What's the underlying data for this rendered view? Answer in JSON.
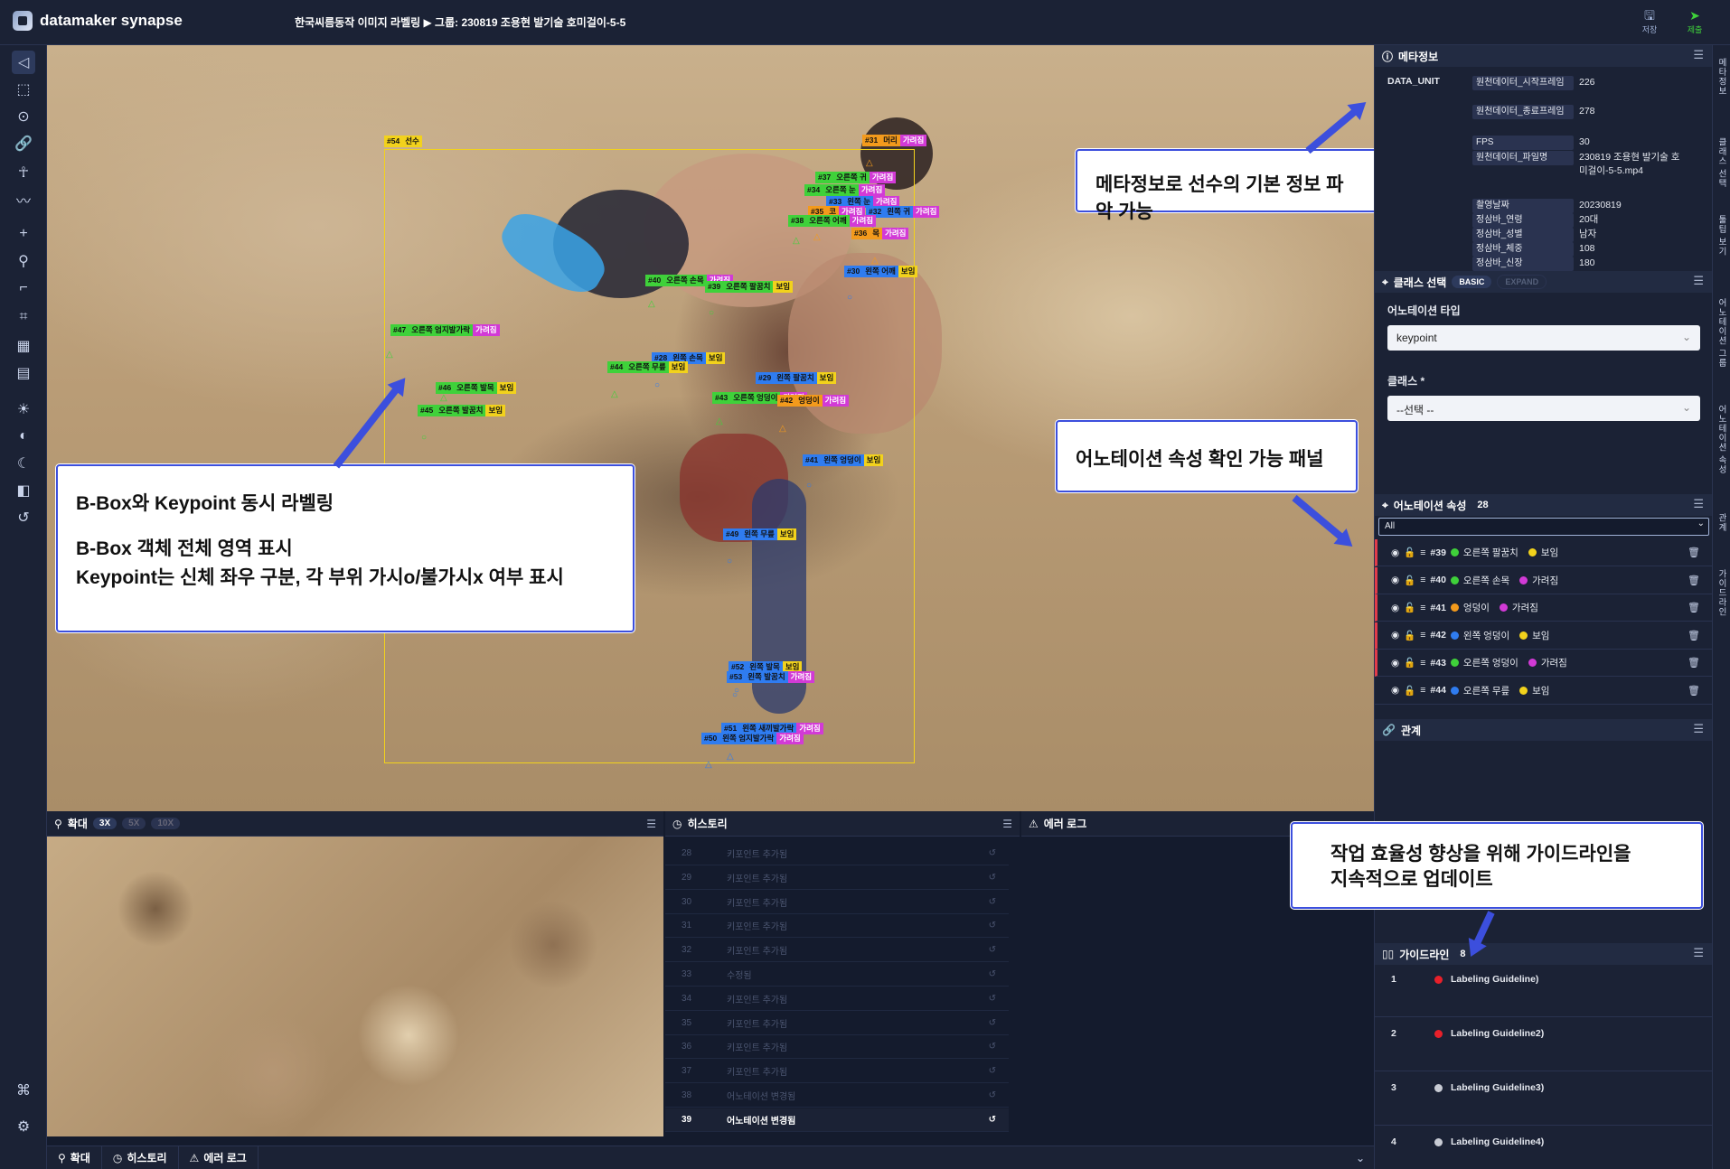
{
  "app": {
    "logo": "datamaker synapse",
    "breadcrumb": "한국씨름동작 이미지 라벨링 ▶ 그룹: 230819 조용현 발기술 호미걸이-5-5",
    "save": "저장",
    "submit": "제출"
  },
  "canvas": {
    "bbox_label": {
      "id": "#54",
      "name": "선수"
    },
    "keypoints": [
      {
        "id": "#31",
        "name": "머리",
        "state": "가려짐",
        "color": "#f39a1c"
      },
      {
        "id": "#37",
        "name": "오른쪽 귀",
        "state": "가려짐",
        "color": "#3fd13a"
      },
      {
        "id": "#34",
        "name": "오른쪽 눈",
        "state": "가려짐",
        "color": "#3fd13a"
      },
      {
        "id": "#33",
        "name": "왼쪽 눈",
        "state": "가려짐",
        "color": "#2f7cf0"
      },
      {
        "id": "#35",
        "name": "코",
        "state": "가려짐",
        "color": "#f39a1c"
      },
      {
        "id": "#32",
        "name": "왼쪽 귀",
        "state": "가려짐",
        "color": "#2f7cf0"
      },
      {
        "id": "#38",
        "name": "오른쪽 어깨",
        "state": "가려짐",
        "color": "#3fd13a"
      },
      {
        "id": "#36",
        "name": "목",
        "state": "가려짐",
        "color": "#f39a1c"
      },
      {
        "id": "#30",
        "name": "왼쪽 어깨",
        "state": "보임",
        "color": "#2f7cf0"
      },
      {
        "id": "#40",
        "name": "오른쪽 손목",
        "state": "가려짐",
        "color": "#3fd13a"
      },
      {
        "id": "#39",
        "name": "오른쪽 팔꿈치",
        "state": "보임",
        "color": "#3fd13a"
      },
      {
        "id": "#47",
        "name": "오른쪽 엄지발가락",
        "state": "가려짐",
        "color": "#3fd13a"
      },
      {
        "id": "#28",
        "name": "왼쪽 손목",
        "state": "보임",
        "color": "#2f7cf0"
      },
      {
        "id": "#44",
        "name": "오른쪽 무릎",
        "state": "보임",
        "color": "#3fd13a"
      },
      {
        "id": "#29",
        "name": "왼쪽 팔꿈치",
        "state": "보임",
        "color": "#2f7cf0"
      },
      {
        "id": "#46",
        "name": "오른쪽 발목",
        "state": "보임",
        "color": "#3fd13a"
      },
      {
        "id": "#43",
        "name": "오른쪽 엉덩이",
        "state": "가려짐",
        "color": "#3fd13a"
      },
      {
        "id": "#42",
        "name": "엉덩이",
        "state": "가려짐",
        "color": "#f39a1c"
      },
      {
        "id": "#45",
        "name": "오른쪽 발꿈치",
        "state": "보임",
        "color": "#3fd13a"
      },
      {
        "id": "#41",
        "name": "왼쪽 엉덩이",
        "state": "보임",
        "color": "#2f7cf0"
      },
      {
        "id": "#49",
        "name": "왼쪽 무릎",
        "state": "보임",
        "color": "#2f7cf0"
      },
      {
        "id": "#52",
        "name": "왼쪽 발목",
        "state": "보임",
        "color": "#2f7cf0"
      },
      {
        "id": "#53",
        "name": "왼쪽 발꿈치",
        "state": "가려짐",
        "color": "#2f7cf0"
      },
      {
        "id": "#51",
        "name": "왼쪽 새끼발가락",
        "state": "가려짐",
        "color": "#2f7cf0"
      },
      {
        "id": "#50",
        "name": "왼쪽 엄지발가락",
        "state": "가려짐",
        "color": "#2f7cf0"
      }
    ]
  },
  "callouts": {
    "left": {
      "line1": "B-Box와 Keypoint 동시 라벨링",
      "line2": "B-Box 객체 전체 영역 표시",
      "line3": "Keypoint는 신체 좌우 구분, 각 부위 가시o/불가시x 여부 표시"
    },
    "meta": "메타정보로 선수의 기본 정보 파악 가능",
    "attr": "어노테이션 속성 확인 가능 패널",
    "guide": {
      "line1": "작업 효율성 향상을 위해 가이드라인을",
      "line2": "지속적으로 업데이트"
    }
  },
  "meta": {
    "title": "메타정보",
    "unit_label": "DATA_UNIT",
    "rows": [
      {
        "key": "원천데이터_시작프레임",
        "value": "226"
      },
      {
        "key": "원천데이터_종료프레임",
        "value": "278"
      },
      {
        "key": "FPS",
        "value": "30"
      },
      {
        "key": "원천데이터_파일명",
        "value": "230819 조용현 발기술 호미걸이-5-5.mp4"
      },
      {
        "key": "촬영날짜",
        "value": "20230819"
      },
      {
        "key": "정삼바_연령",
        "value": "20대"
      },
      {
        "key": "정삼바_성별",
        "value": "남자"
      },
      {
        "key": "정삼바_체중",
        "value": "108"
      },
      {
        "key": "정삼바_신장",
        "value": "180"
      }
    ]
  },
  "class_select": {
    "title": "클래스 선택",
    "tab_basic": "BASIC",
    "tab_expand": "EXPAND",
    "type_label": "어노테이션 타입",
    "type_value": "keypoint",
    "class_label": "클래스 *",
    "class_value": "--선택 --"
  },
  "attr_panel": {
    "title": "어노테이션 속성",
    "count": "28",
    "filter": "All",
    "rows": [
      {
        "id": "#39",
        "name": "오른쪽 팔꿈치",
        "color": "#3fd13a",
        "state": "보임",
        "state_color": "#f2d21c",
        "err": true
      },
      {
        "id": "#40",
        "name": "오른쪽 손목",
        "color": "#3fd13a",
        "state": "가려짐",
        "state_color": "#d23ad6",
        "err": true
      },
      {
        "id": "#41",
        "name": "엉덩이",
        "color": "#f39a1c",
        "state": "가려짐",
        "state_color": "#d23ad6",
        "err": true
      },
      {
        "id": "#42",
        "name": "왼쪽 엉덩이",
        "color": "#2f7cf0",
        "state": "보임",
        "state_color": "#f2d21c",
        "err": true
      },
      {
        "id": "#43",
        "name": "오른쪽 엉덩이",
        "color": "#3fd13a",
        "state": "가려짐",
        "state_color": "#d23ad6",
        "err": true
      },
      {
        "id": "#44",
        "name": "오른쪽 무릎",
        "color": "#2f7cf0",
        "state": "보임",
        "state_color": "#f2d21c",
        "err": false
      }
    ]
  },
  "relation": {
    "title": "관계"
  },
  "guide": {
    "title": "가이드라인",
    "count": "8",
    "rows": [
      {
        "n": "1",
        "label": "Labeling Guideline)",
        "color": "#e8202a"
      },
      {
        "n": "2",
        "label": "Labeling Guideline2)",
        "color": "#e8202a"
      },
      {
        "n": "3",
        "label": "Labeling Guideline3)",
        "color": "#c8cbd4"
      },
      {
        "n": "4",
        "label": "Labeling Guideline4)",
        "color": "#c8cbd4"
      }
    ]
  },
  "right_tabs": [
    "메타정보",
    "클래스 선택",
    "툴팁 보기",
    "어노테이션 그룹",
    "어노테이션 속성",
    "관계",
    "가이드라인"
  ],
  "zoom": {
    "title": "확대",
    "levels": [
      "3X",
      "5X",
      "10X"
    ]
  },
  "history": {
    "title": "히스토리",
    "rows": [
      {
        "n": "28",
        "label": "키포인트 추가됨"
      },
      {
        "n": "29",
        "label": "키포인트 추가됨"
      },
      {
        "n": "30",
        "label": "키포인트 추가됨"
      },
      {
        "n": "31",
        "label": "키포인트 추가됨"
      },
      {
        "n": "32",
        "label": "키포인트 추가됨"
      },
      {
        "n": "33",
        "label": "수정됨"
      },
      {
        "n": "34",
        "label": "키포인트 추가됨"
      },
      {
        "n": "35",
        "label": "키포인트 추가됨"
      },
      {
        "n": "36",
        "label": "키포인트 추가됨"
      },
      {
        "n": "37",
        "label": "키포인트 추가됨"
      },
      {
        "n": "38",
        "label": "어노테이션 변경됨"
      },
      {
        "n": "39",
        "label": "어노테이션 변경됨"
      }
    ]
  },
  "errorlog": {
    "title": "에러 로그"
  },
  "bottombar": {
    "zoom": "확대",
    "history": "히스토리",
    "error": "에러 로그"
  }
}
